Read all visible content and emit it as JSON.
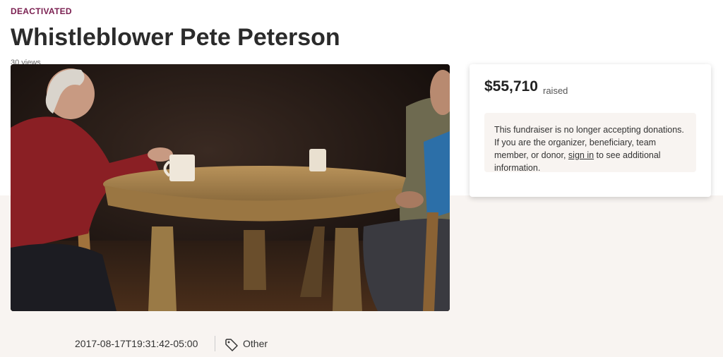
{
  "status_label": "DEACTIVATED",
  "title": "Whistleblower Pete Peterson",
  "video": {
    "views_text": "30 views"
  },
  "donation_card": {
    "amount": "$55,710",
    "amount_label": "raised",
    "notice_before": "This fundraiser is no longer accepting donations. If you are the organizer, beneficiary, team member, or donor, ",
    "sign_in_link": "sign in",
    "notice_after": " to see additional information."
  },
  "meta": {
    "created": "2017-08-17T19:31:42-05:00",
    "category_icon": "tag-icon",
    "category": "Other"
  },
  "colors": {
    "status": "#7a1f50",
    "band": "#f8f4f1"
  }
}
